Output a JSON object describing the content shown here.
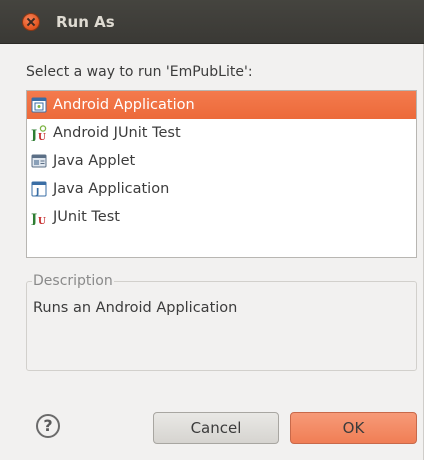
{
  "window": {
    "title": "Run As"
  },
  "prompt": "Select a way to run 'EmPubLite':",
  "launch_options": [
    {
      "label": "Android Application",
      "icon": "android-application-icon",
      "selected": true
    },
    {
      "label": "Android JUnit Test",
      "icon": "android-junit-icon",
      "selected": false
    },
    {
      "label": "Java Applet",
      "icon": "java-applet-icon",
      "selected": false
    },
    {
      "label": "Java Application",
      "icon": "java-application-icon",
      "selected": false
    },
    {
      "label": "JUnit Test",
      "icon": "junit-icon",
      "selected": false
    }
  ],
  "description": {
    "legend": "Description",
    "text": "Runs an Android Application"
  },
  "buttons": {
    "help": "?",
    "cancel": "Cancel",
    "ok": "OK"
  },
  "colors": {
    "accent": "#f07746",
    "titlebar": "#3f3e3a",
    "background": "#f2f1f0"
  }
}
